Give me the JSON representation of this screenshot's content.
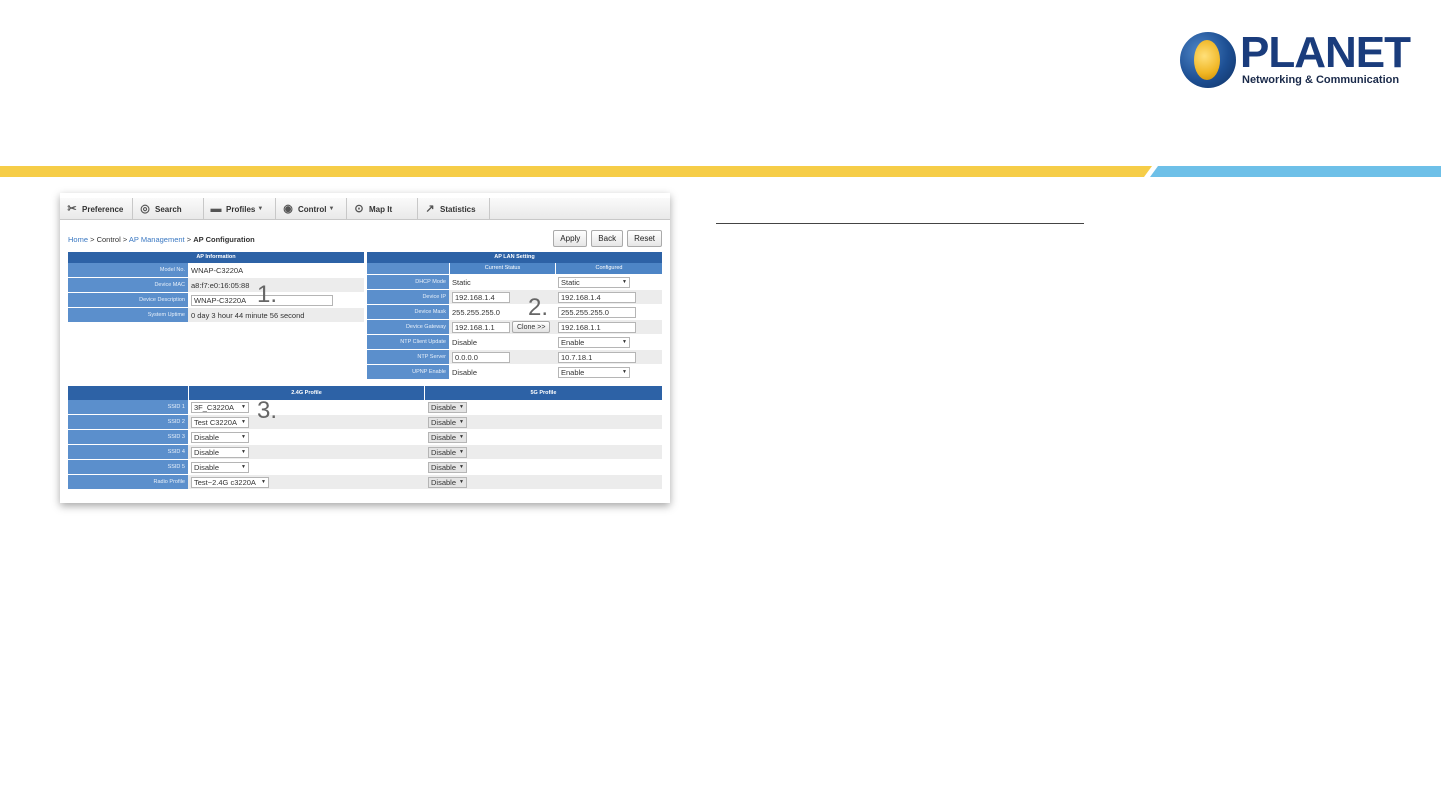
{
  "logo": {
    "word": "PLANET",
    "tagline": "Networking & Communication"
  },
  "nav": {
    "items": [
      {
        "label": "Preference",
        "icon": "tools-icon",
        "glyph": "✂",
        "caret": false
      },
      {
        "label": "Search",
        "icon": "globe-icon",
        "glyph": "◎",
        "caret": false
      },
      {
        "label": "Profiles",
        "icon": "folder-icon",
        "glyph": "▬",
        "caret": true
      },
      {
        "label": "Control",
        "icon": "steering-wheel-icon",
        "glyph": "◉",
        "caret": true
      },
      {
        "label": "Map It",
        "icon": "map-pin-icon",
        "glyph": "⊙",
        "caret": false
      },
      {
        "label": "Statistics",
        "icon": "chart-arrow-icon",
        "glyph": "↗",
        "caret": false
      }
    ],
    "caret_glyph": "▼"
  },
  "breadcrumb": {
    "home": "Home",
    "sep": " > ",
    "control": "Control",
    "ap_management": "AP Management",
    "current": "AP Configuration"
  },
  "buttons": {
    "apply": "Apply",
    "back": "Back",
    "reset": "Reset"
  },
  "ap_info": {
    "title": "AP Information",
    "rows": [
      {
        "label": "Model No.",
        "value": "WNAP-C3220A"
      },
      {
        "label": "Device MAC",
        "value": "a8:f7:e0:16:05:88"
      },
      {
        "label": "Device Description",
        "value": "WNAP-C3220A"
      },
      {
        "label": "System Uptime",
        "value": "0 day 3 hour 44 minute 56 second"
      }
    ]
  },
  "ap_lan": {
    "title": "AP LAN Setting",
    "col_current": "Current Status",
    "col_config": "Configured",
    "clone_label": "Clone >>",
    "rows": [
      {
        "label": "DHCP Mode",
        "current": "Static",
        "config": "Static",
        "config_type": "select"
      },
      {
        "label": "Device IP",
        "current": "192.168.1.4",
        "config": "192.168.1.4",
        "config_type": "input"
      },
      {
        "label": "Device Mask",
        "current": "255.255.255.0",
        "config": "255.255.255.0",
        "config_type": "input"
      },
      {
        "label": "Device Gateway",
        "current": "192.168.1.1",
        "config": "192.168.1.1",
        "config_type": "input"
      },
      {
        "label": "NTP Client Update",
        "current": "Disable",
        "config": "Enable",
        "config_type": "select"
      },
      {
        "label": "NTP Server",
        "current": "0.0.0.0",
        "config": "10.7.18.1",
        "config_type": "input"
      },
      {
        "label": "UPNP Enable",
        "current": "Disable",
        "config": "Enable",
        "config_type": "select"
      }
    ]
  },
  "profiles": {
    "col_24g": "2.4G Profile",
    "col_5g": "5G Profile",
    "rows": [
      {
        "label": "SSID 1",
        "p24": "3F_C3220A",
        "p5": "Disable"
      },
      {
        "label": "SSID 2",
        "p24": "Test C3220A",
        "p5": "Disable"
      },
      {
        "label": "SSID 3",
        "p24": "Disable",
        "p5": "Disable"
      },
      {
        "label": "SSID 4",
        "p24": "Disable",
        "p5": "Disable"
      },
      {
        "label": "SSID 5",
        "p24": "Disable",
        "p5": "Disable"
      },
      {
        "label": "Radio Profile",
        "p24": "Test~2.4G c3220A",
        "p5": "Disable"
      }
    ]
  },
  "steps": {
    "s1": "1.",
    "s2": "2.",
    "s3": "3."
  },
  "colors": {
    "stripe_yellow": "#f6cd48",
    "stripe_blue": "#6ec0e8",
    "table_header": "#2d62a6",
    "label_cell": "#5b8fcc",
    "link": "#3a78c2"
  }
}
